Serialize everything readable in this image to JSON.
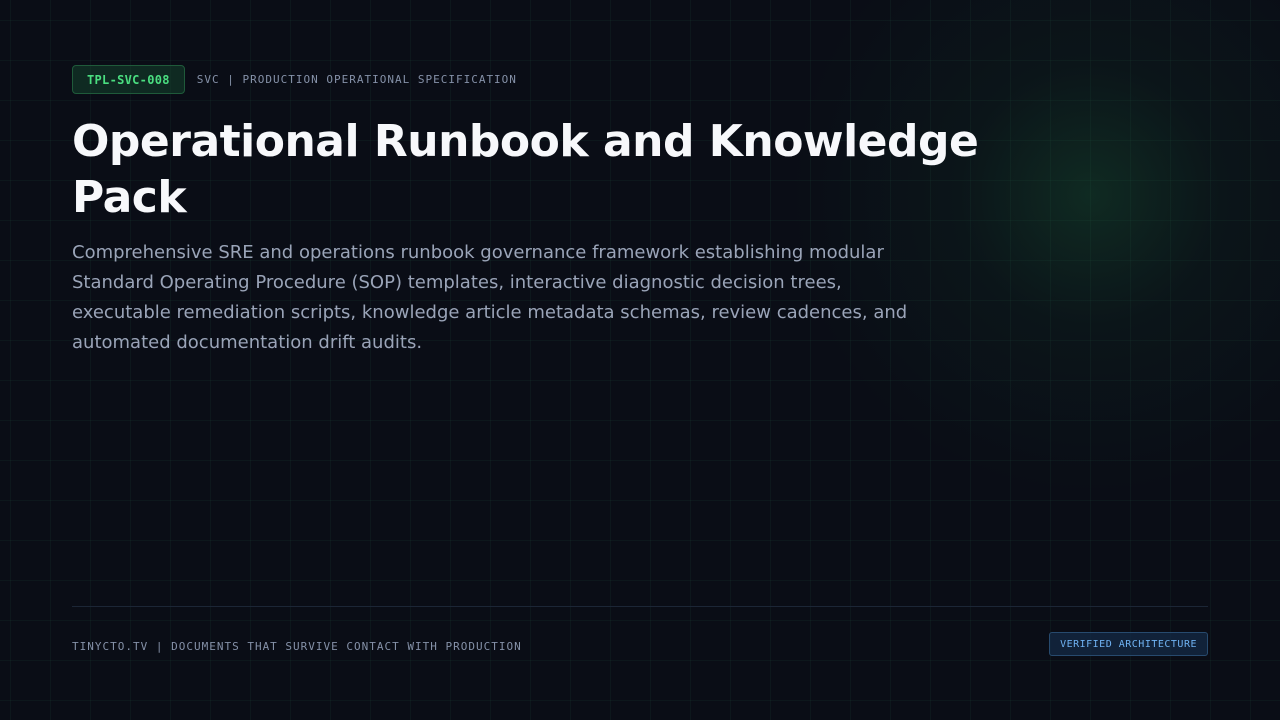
{
  "header": {
    "doc_code": "TPL-SVC-008",
    "category": "SVC | PRODUCTION OPERATIONAL SPECIFICATION"
  },
  "main": {
    "title": "Operational Runbook and Knowledge Pack",
    "description": "Comprehensive SRE and operations runbook governance framework establishing modular Standard Operating Procedure (SOP) templates, interactive diagnostic decision trees, executable remediation scripts, knowledge article metadata schemas, review cadences, and automated documentation drift audits."
  },
  "footer": {
    "tagline": "TINYCTO.TV | DOCUMENTS THAT SURVIVE CONTACT WITH PRODUCTION",
    "badge": "VERIFIED ARCHITECTURE"
  },
  "colors": {
    "background": "#0a0d16",
    "accent_green": "#4ade80",
    "accent_blue": "#6fb2f2",
    "title_text": "#f7f8fb",
    "body_text": "#9aa4b8"
  }
}
